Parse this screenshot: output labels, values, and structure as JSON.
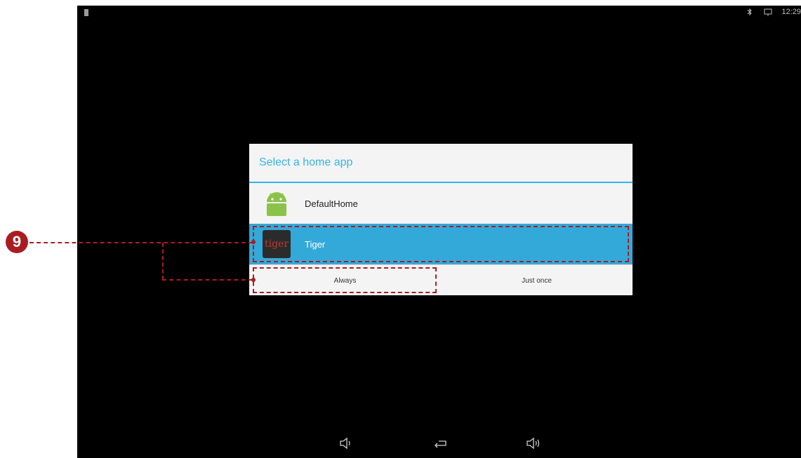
{
  "status_bar": {
    "time": "12:29"
  },
  "dialog": {
    "title": "Select a home app",
    "apps": [
      {
        "label": "DefaultHome",
        "icon": "android-icon",
        "selected": false
      },
      {
        "label": "Tiger",
        "icon": "tiger-app-icon",
        "icon_text": "tiger",
        "selected": true
      }
    ],
    "buttons": {
      "always": "Always",
      "just_once": "Just once"
    }
  },
  "navigation": {
    "buttons": [
      "volume-down-icon",
      "back-icon",
      "volume-up-icon"
    ]
  },
  "annotation": {
    "number": "9",
    "color": "#a91d22"
  },
  "colors": {
    "accent": "#33b5e5",
    "selected_row": "#33a9d9"
  }
}
